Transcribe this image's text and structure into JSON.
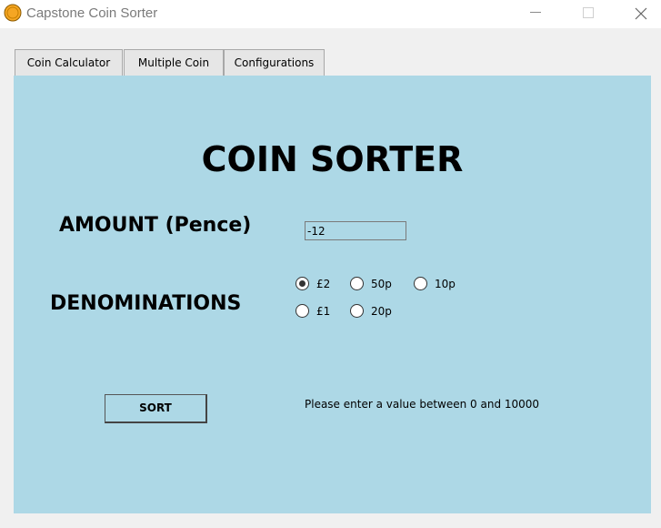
{
  "window": {
    "title": "Capstone Coin Sorter",
    "icon": "coin-icon"
  },
  "tabs": [
    {
      "label": "Coin Calculator"
    },
    {
      "label": "Multiple Coin"
    },
    {
      "label": "Configurations"
    }
  ],
  "main": {
    "heading": "COIN SORTER",
    "amount_label": "AMOUNT (Pence)",
    "amount_value": "-12",
    "denominations_label": "DENOMINATIONS",
    "denominations": [
      {
        "label": "£2",
        "checked": true
      },
      {
        "label": "50p",
        "checked": false
      },
      {
        "label": "10p",
        "checked": false
      },
      {
        "label": "£1",
        "checked": false
      },
      {
        "label": "20p",
        "checked": false
      }
    ],
    "sort_label": "SORT",
    "message": "Please enter a value between 0 and 10000"
  },
  "colors": {
    "panel_background": "#add8e6",
    "coin_icon": "#f5a623"
  }
}
